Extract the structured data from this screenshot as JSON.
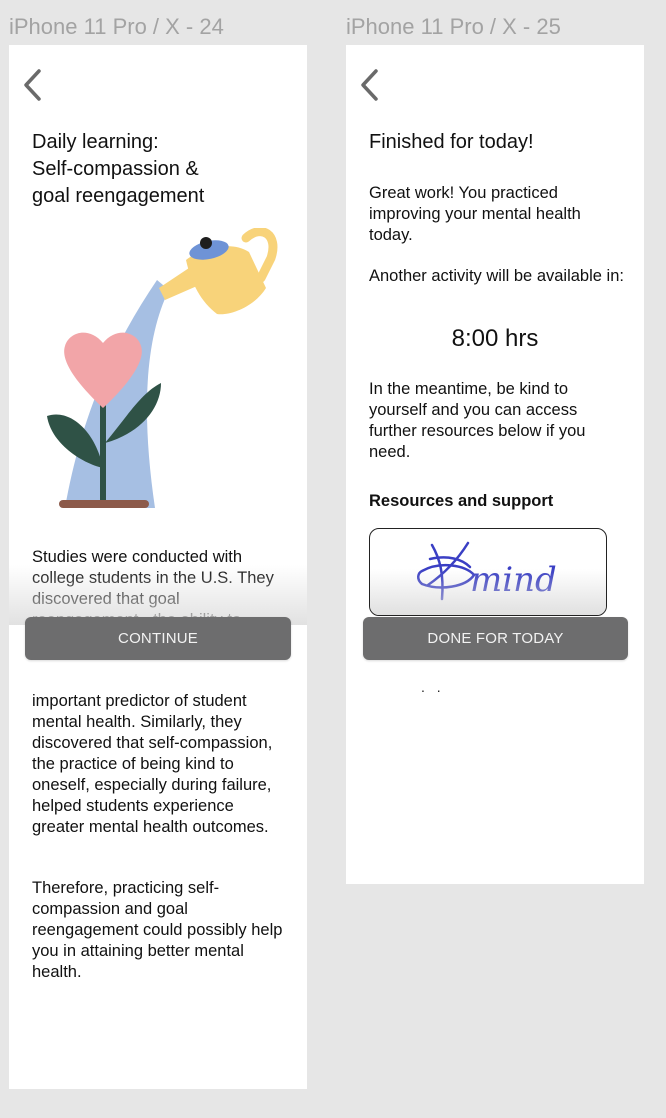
{
  "frames": [
    {
      "label": "iPhone 11 Pro / X - 24",
      "title_line1": "Daily learning:",
      "title_line2": "Self-compassion &",
      "title_line3": "goal reengagement",
      "intro_text": "Studies were conducted with college students in the U.S. They discovered that goal reengagement - the ability to",
      "continue_label": "CONTINUE",
      "body_paragraph1": "important predictor of student mental health. Similarly, they discovered that self-compassion, the practice of being kind to oneself, especially during failure, helped students experience greater mental health outcomes.",
      "body_paragraph2": "Therefore, practicing self-compassion and goal reengagement could possibly help you in attaining better mental health."
    },
    {
      "label": "iPhone 11 Pro / X - 25",
      "title": "Finished for today!",
      "praise_text": "Great work! You practiced improving your mental health today.",
      "next_activity_text": "Another activity will be available in:",
      "timer": "8:00 hrs",
      "meantime_text": "In the meantime, be kind to yourself and you can access further resources below if you need.",
      "resources_heading": "Resources and support",
      "mind_logo_text": "mind",
      "done_label": "DONE FOR TODAY",
      "ellipsis": ". ."
    }
  ],
  "colors": {
    "background": "#e6e6e6",
    "frame_label": "#a3a3a3",
    "button": "#6d6d6e",
    "button_text": "#f2f2f2",
    "heart": "#f2a5a8",
    "leaf": "#2f5246",
    "water_stream": "#a6bfe3",
    "watering_can": "#f8d37a",
    "can_lid": "#6e93d6",
    "soil": "#8c5a4a",
    "mind_logo": "#3a3fc4"
  },
  "icons": {
    "back": "chevron-left-icon",
    "illustration": "watering-can-heart-plant-illustration",
    "logo": "mind-logo"
  }
}
